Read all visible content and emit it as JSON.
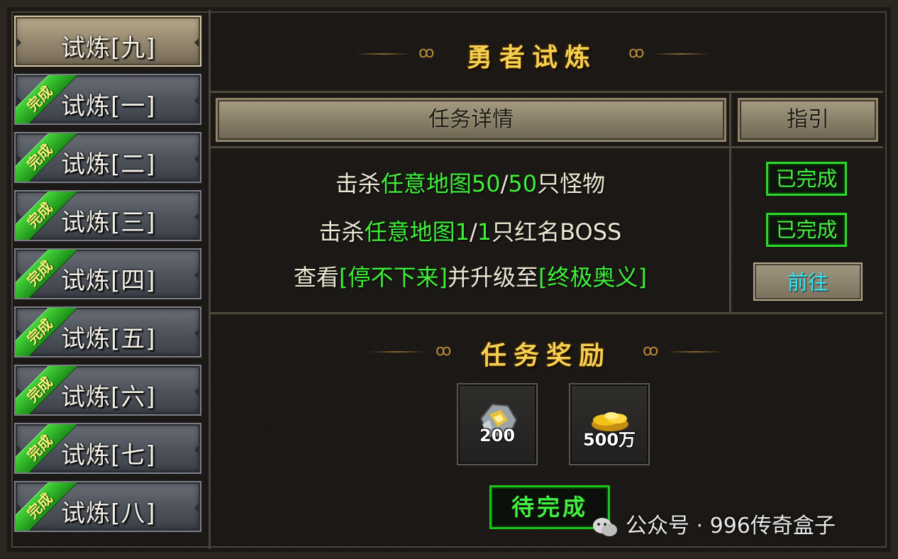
{
  "sidebar": {
    "items": [
      {
        "label": "试炼[九]",
        "done": false,
        "active": true
      },
      {
        "label": "试炼[一]",
        "done": true,
        "active": false
      },
      {
        "label": "试炼[二]",
        "done": true,
        "active": false
      },
      {
        "label": "试炼[三]",
        "done": true,
        "active": false
      },
      {
        "label": "试炼[四]",
        "done": true,
        "active": false
      },
      {
        "label": "试炼[五]",
        "done": true,
        "active": false
      },
      {
        "label": "试炼[六]",
        "done": true,
        "active": false
      },
      {
        "label": "试炼[七]",
        "done": true,
        "active": false
      },
      {
        "label": "试炼[八]",
        "done": true,
        "active": false
      }
    ],
    "done_badge": "完成"
  },
  "main": {
    "title": "勇者试炼",
    "headers": {
      "details": "任务详情",
      "guide": "指引"
    },
    "tasks": [
      {
        "prefix": "击杀",
        "target": "任意地图",
        "progress": "50",
        "sep": "/",
        "total": "50",
        "suffix": "只怪物",
        "status": "已完成"
      },
      {
        "prefix": "击杀",
        "target": "任意地图",
        "progress": "1",
        "sep": "/",
        "total": "1",
        "suffix": "只红名BOSS",
        "status": "已完成"
      },
      {
        "prefix": "查看",
        "item1": "[停不下来]",
        "middle": "并升级至",
        "item2": "[终极奥义]",
        "action": "前往"
      }
    ],
    "rewards_title": "任务奖励",
    "rewards": [
      {
        "icon": "ore-icon",
        "count": "200"
      },
      {
        "icon": "gold-icon",
        "count": "500万"
      }
    ],
    "pending_label": "待完成"
  },
  "watermark": {
    "text": "公众号 · 996传奇盒子"
  },
  "colors": {
    "green": "#3ef03a",
    "gold": "#f5cf4f",
    "cyan": "#36e6f2"
  }
}
